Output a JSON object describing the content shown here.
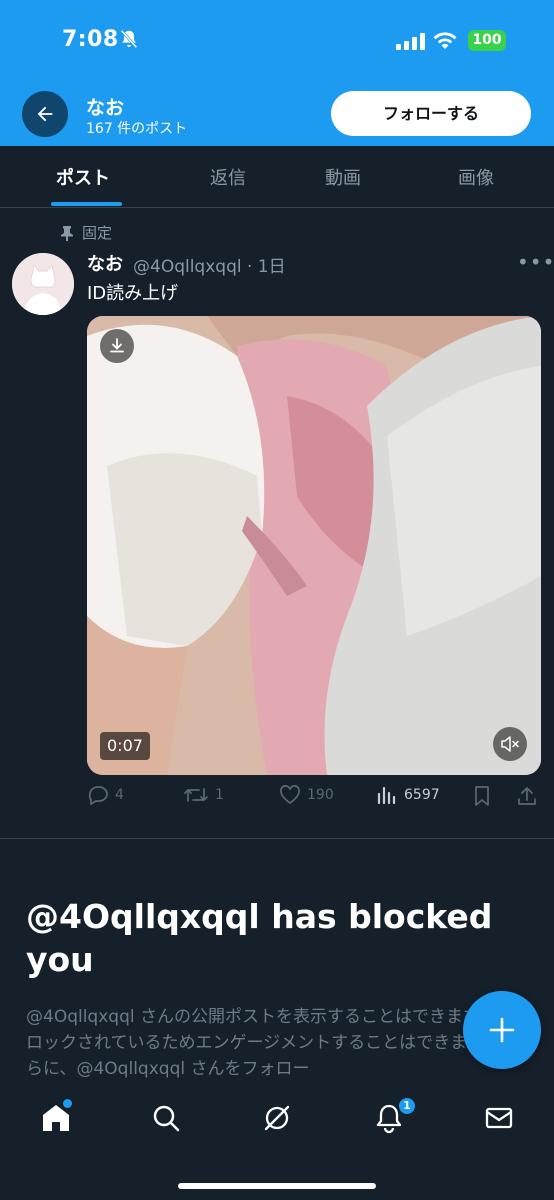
{
  "status_bar": {
    "time": "7:08",
    "battery": "100"
  },
  "header": {
    "name": "なお",
    "post_count": "167 件のポスト",
    "follow_label": "フォローする"
  },
  "tabs": [
    {
      "label": "ポスト",
      "active": true
    },
    {
      "label": "返信",
      "active": false
    },
    {
      "label": "動画",
      "active": false
    },
    {
      "label": "画像",
      "active": false
    }
  ],
  "post": {
    "pinned_label": "固定",
    "author": "なお",
    "handle_time": "@4Oqllqxqql · 1日",
    "text": "ID読み上げ",
    "video_duration": "0:07",
    "actions": {
      "replies": "4",
      "reposts": "1",
      "likes": "190",
      "views": "6597"
    }
  },
  "blocked": {
    "title": "@4Oqllqxqql has blocked you",
    "description": "@4Oqllqxqql さんの公開ポストを表示することはできますが、ブロックされているためエンゲージメントすることはできません。さらに、@4Oqllqxqql さんをフォロー"
  },
  "bottom_nav": {
    "notifications_badge": "1"
  },
  "colors": {
    "accent": "#1d9bf0",
    "background": "#15202b"
  }
}
